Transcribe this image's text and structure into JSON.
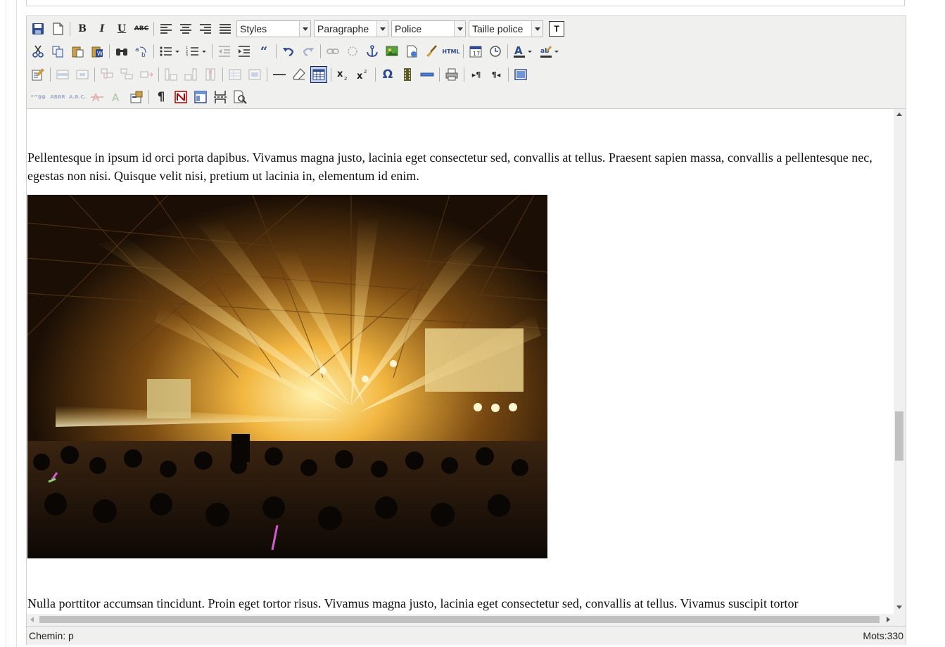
{
  "editor": {
    "toolbar": {
      "row1": {
        "buttons": [
          "save-icon",
          "new-document-icon",
          "bold-icon",
          "italic-icon",
          "underline-icon",
          "strikethrough-icon",
          "align-left-icon",
          "align-center-icon",
          "align-right-icon",
          "align-justify-icon"
        ],
        "styles_select": "Styles",
        "format_select": "Paragraphe",
        "font_select": "Police",
        "size_select": "Taille police",
        "text_button": "T"
      },
      "row2": [
        "cut-icon",
        "copy-icon",
        "paste-icon",
        "paste-word-icon",
        "find-icon",
        "replace-icon",
        "bullet-list-icon",
        "numbered-list-icon",
        "outdent-icon",
        "indent-icon",
        "blockquote-icon",
        "undo-icon",
        "redo-icon",
        "link-icon",
        "unlink-icon",
        "anchor-icon",
        "image-icon",
        "cleanup-icon",
        "brush-icon",
        "html-icon",
        "insert-date-icon",
        "insert-time-icon",
        "text-color-icon",
        "highlight-color-icon"
      ],
      "row3": [
        "edit-icon",
        "table-row-icon",
        "table-col-icon",
        "table-split-icon",
        "merge-cells-icon",
        "col-before-icon",
        "col-after-icon",
        "col-delete-icon",
        "table-props-icon",
        "cell-props-icon",
        "horizontal-rule-icon",
        "eraser-icon",
        "table-icon",
        "subscript-icon",
        "superscript-icon",
        "special-char-icon",
        "media-icon",
        "hr-advanced-icon",
        "print-icon",
        "ltr-icon",
        "rtl-icon",
        "fullscreen-icon"
      ],
      "row4": [
        "cite-icon",
        "abbr-icon",
        "acronym-icon",
        "delete-text-icon",
        "insert-text-icon",
        "attributes-icon",
        "visual-chars-icon",
        "nonbreaking-icon",
        "template-icon",
        "pagebreak-icon",
        "preview-icon"
      ],
      "icon_color": "#2e4b8f",
      "active_color": "#c2cfe5"
    },
    "content": {
      "paragraph1": "Pellentesque in ipsum id orci porta dapibus. Vivamus magna justo, lacinia eget consectetur sed, convallis at tellus. Praesent sapien massa, convallis a pellentesque nec, egestas non nisi. Quisque velit nisi, pretium ut lacinia in, elementum id enim.",
      "image": "concert-photo",
      "paragraph2": "Nulla porttitor accumsan tincidunt. Proin eget tortor risus. Vivamus magna justo, lacinia eget consectetur sed, convallis at tellus. Vivamus suscipit tortor"
    },
    "statusbar": {
      "path": "Chemin: p",
      "word_count": "Mots:330"
    }
  }
}
